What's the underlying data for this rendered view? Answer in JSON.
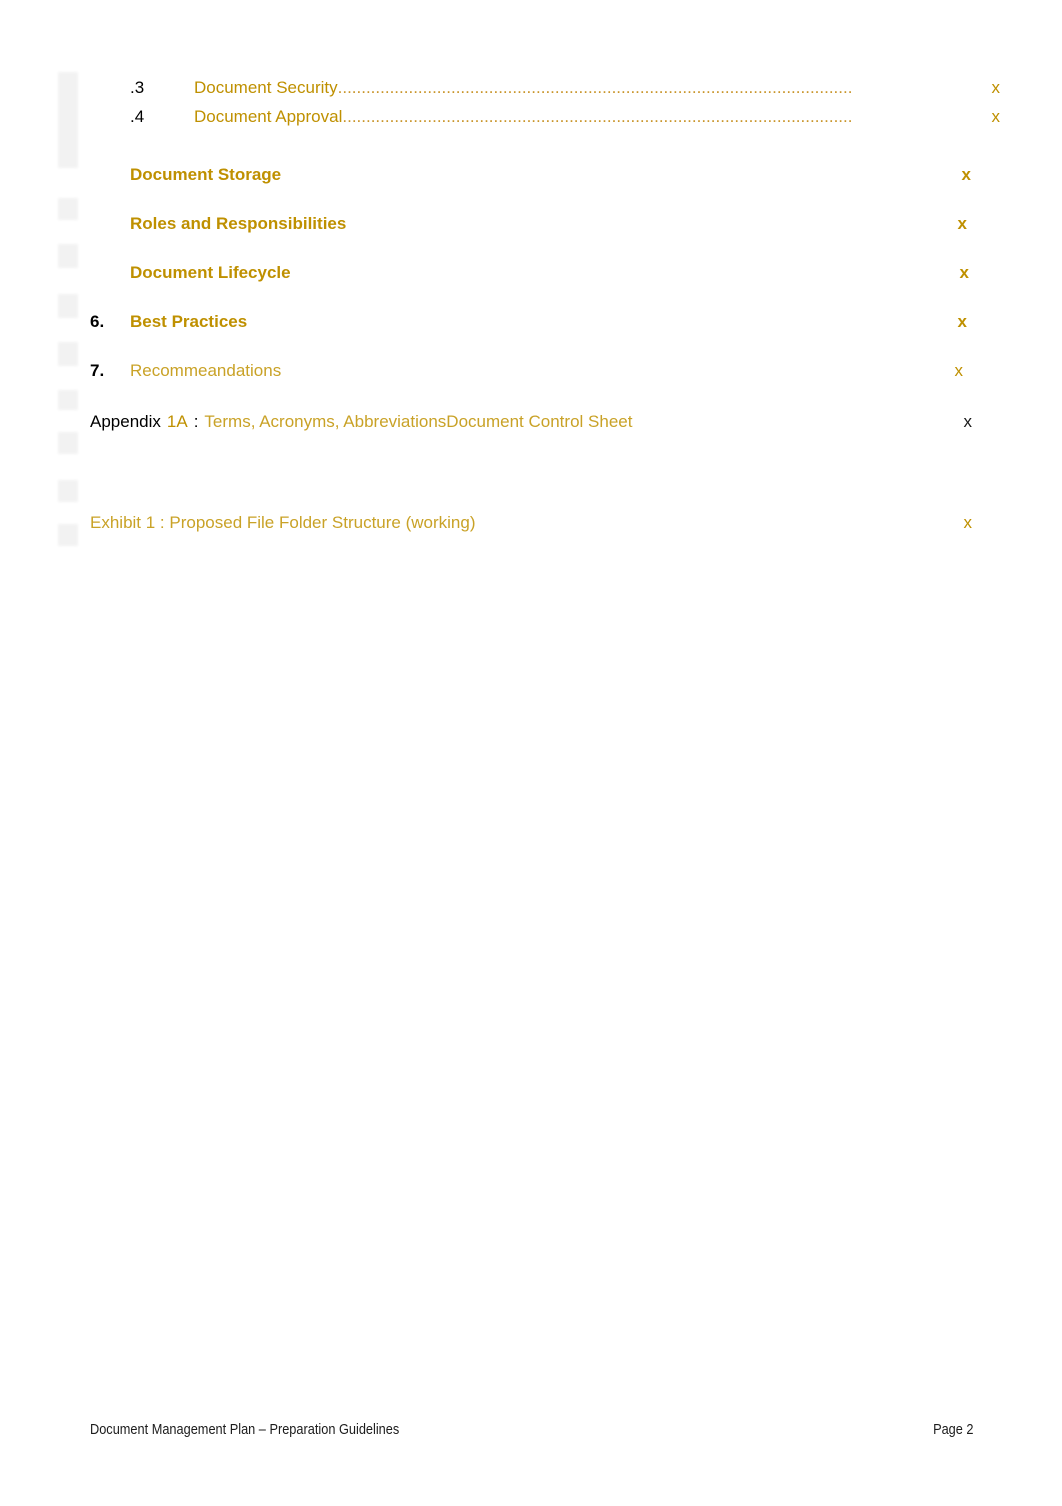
{
  "document": {
    "footer_left": "Document Management Plan – Preparation Guidelines",
    "footer_right": "Page 2"
  },
  "colors": {
    "heading_gold": "#bf9000",
    "light_gold": "#c9a227",
    "leader_gold": "#c9952a",
    "body_black": "#000000",
    "band_tint": "#f6f7e5"
  },
  "toc": {
    "entries": [
      {
        "number": ".3",
        "title": "Document Security",
        "page": "x",
        "style": "sub",
        "leader": "............................................................................................................."
      },
      {
        "number": ".4",
        "title": "Document Approval",
        "page": "x",
        "style": "sub",
        "leader": "............................................................................................................"
      },
      {
        "number": "",
        "title": "Document Storage",
        "page": "x",
        "style": "heading",
        "leader": ""
      },
      {
        "number": "",
        "title": "Roles and Responsibilities",
        "page": "x",
        "style": "heading",
        "leader": ""
      },
      {
        "number": "",
        "title": "Document Lifecycle",
        "page": "x",
        "style": "heading",
        "leader": ""
      },
      {
        "number": "6.",
        "title": "Best Practices",
        "page": "x",
        "style": "heading-numbered",
        "leader": ""
      },
      {
        "number": "7.",
        "title": "Recommeandations",
        "page": "x",
        "style": "heading-light",
        "leader": ""
      }
    ],
    "appendix": {
      "label": "Appendix",
      "id": "1A",
      "separator": ":",
      "title": "Terms, Acronyms, Abbreviations",
      "title_continued": "Document Control Sheet",
      "page": "x"
    },
    "exhibit": {
      "label": "Exhibit 1 : Proposed File Folder Structure (working)",
      "page": "x"
    }
  }
}
